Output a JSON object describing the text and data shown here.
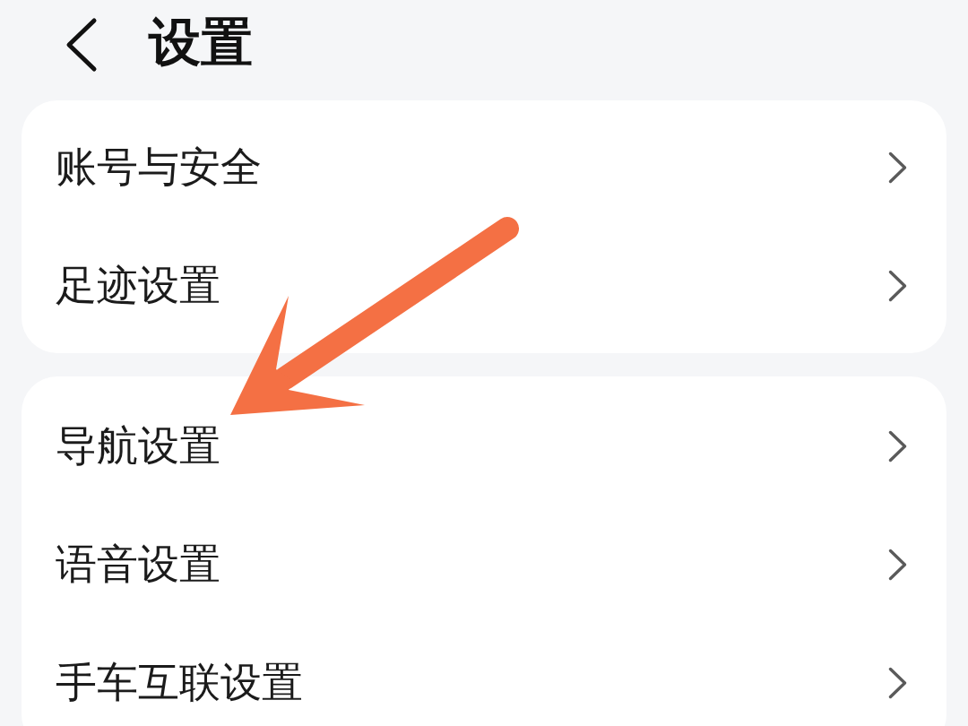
{
  "header": {
    "title": "设置"
  },
  "groups": [
    {
      "items": [
        {
          "label": "账号与安全"
        },
        {
          "label": "足迹设置"
        }
      ]
    },
    {
      "items": [
        {
          "label": "导航设置"
        },
        {
          "label": "语音设置"
        },
        {
          "label": "手车互联设置"
        }
      ]
    }
  ]
}
